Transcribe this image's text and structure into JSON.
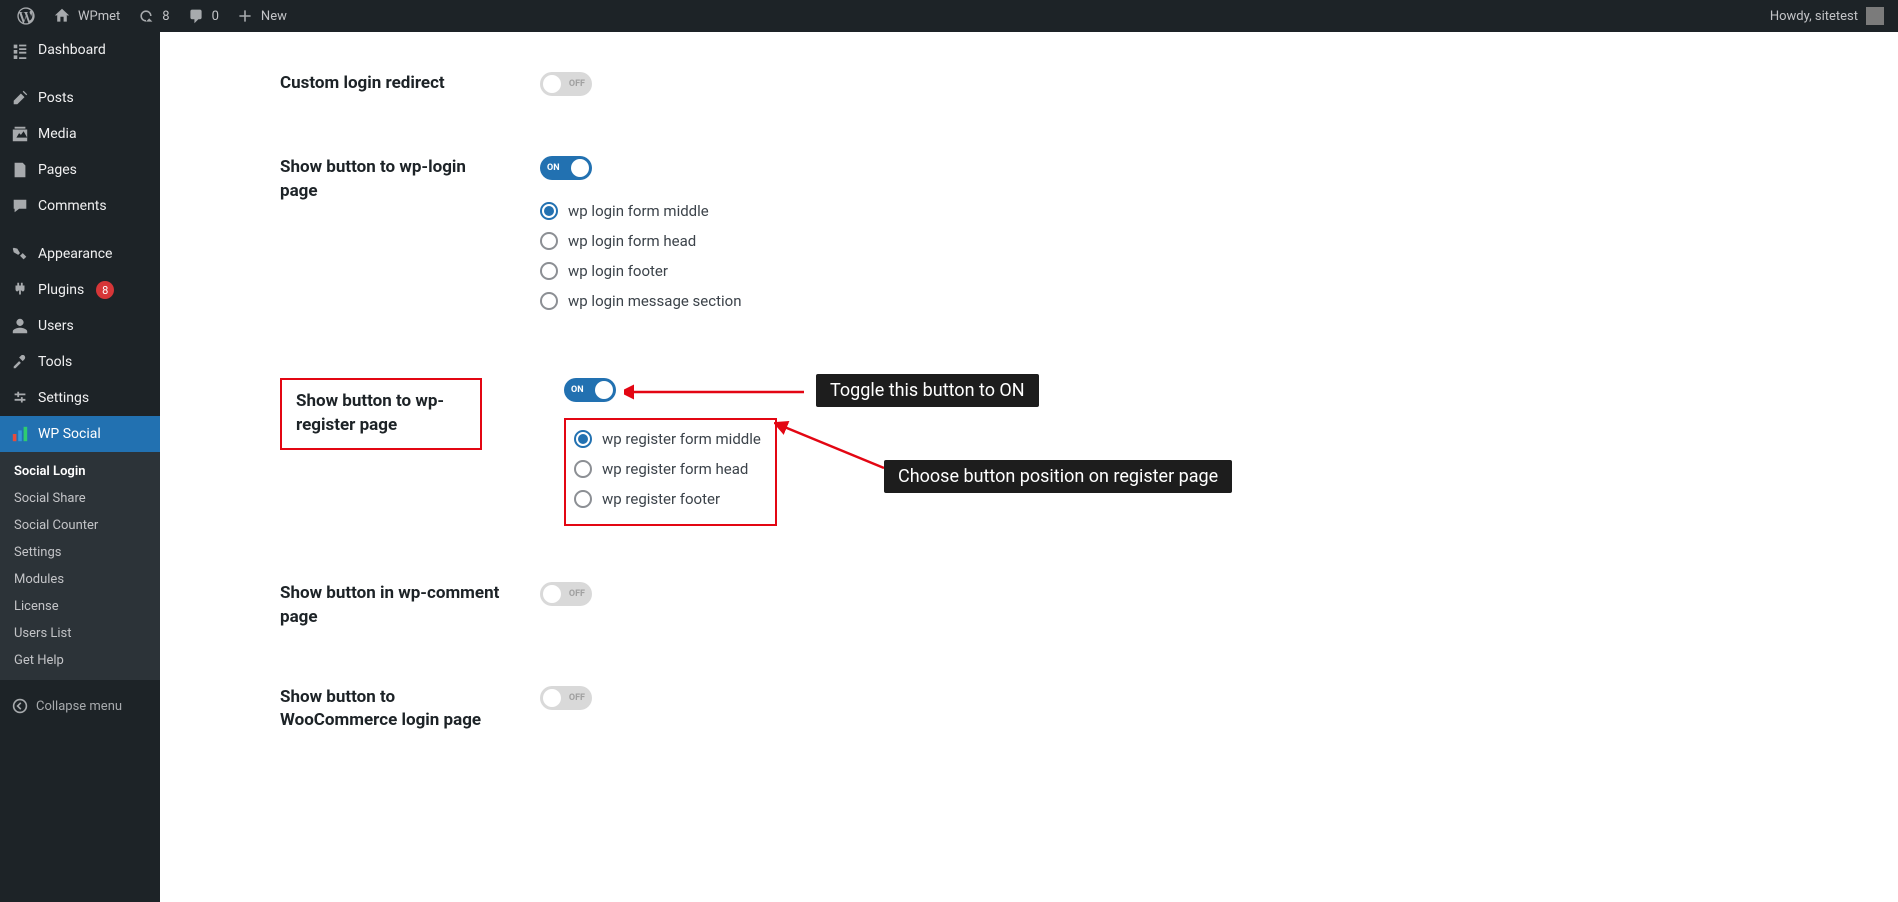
{
  "adminBar": {
    "siteName": "WPmet",
    "updates": "8",
    "comments": "0",
    "newLabel": "New",
    "greeting": "Howdy, sitetest"
  },
  "sidebar": {
    "dashboard": "Dashboard",
    "posts": "Posts",
    "media": "Media",
    "pages": "Pages",
    "commentsLabel": "Comments",
    "appearance": "Appearance",
    "plugins": "Plugins",
    "pluginsBadge": "8",
    "users": "Users",
    "tools": "Tools",
    "settings": "Settings",
    "wpsocial": "WP Social",
    "submenu": {
      "socialLogin": "Social Login",
      "socialShare": "Social Share",
      "socialCounter": "Social Counter",
      "settings": "Settings",
      "modules": "Modules",
      "license": "License",
      "usersList": "Users List",
      "getHelp": "Get Help"
    },
    "collapse": "Collapse menu"
  },
  "settingsBody": {
    "customLoginRedirect": {
      "label": "Custom login redirect",
      "state": "OFF"
    },
    "showWpLogin": {
      "label": "Show button to wp-login page",
      "state": "ON",
      "options": [
        "wp login form middle",
        "wp login form head",
        "wp login footer",
        "wp login message section"
      ]
    },
    "showWpRegister": {
      "label": "Show button to wp-register page",
      "state": "ON",
      "options": [
        "wp register form middle",
        "wp register form head",
        "wp register footer"
      ]
    },
    "showWpComment": {
      "label": "Show button in wp-comment page",
      "state": "OFF"
    },
    "showWoo": {
      "label": "Show button to WooCommerce login page",
      "state": "OFF"
    }
  },
  "annotations": {
    "toggleNote": "Toggle this button to ON",
    "positionNote": "Choose button position on register page"
  }
}
